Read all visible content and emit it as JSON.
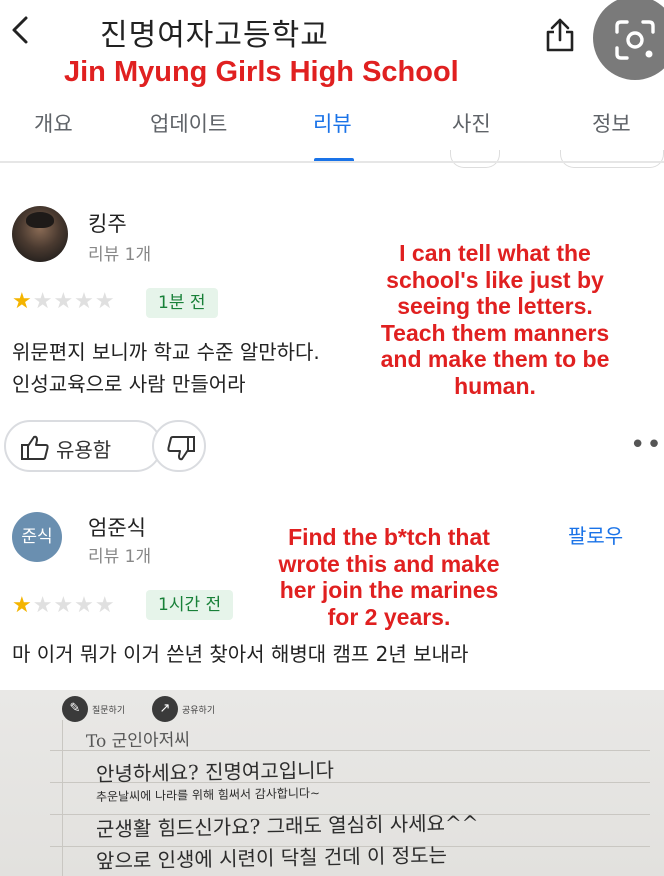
{
  "header": {
    "title_ko": "진명여자고등학교",
    "title_en": "Jin Myung Girls High School"
  },
  "tabs": [
    {
      "label": "개요",
      "active": false
    },
    {
      "label": "업데이트",
      "active": false
    },
    {
      "label": "리뷰",
      "active": true
    },
    {
      "label": "사진",
      "active": false
    },
    {
      "label": "정보",
      "active": false
    }
  ],
  "reviews": [
    {
      "author": "킹주",
      "review_count": "리뷰 1개",
      "rating": 1,
      "time": "1분 전",
      "text_lines": [
        "위문편지 보니까 학교 수준 알만하다.",
        "인성교육으로 사람 만들어라"
      ],
      "translation_lines": [
        "I can tell what the",
        "school's like just by",
        "seeing the letters.",
        "Teach them manners",
        "and make them to be",
        "human."
      ],
      "helpful_label": "유용함"
    },
    {
      "author": "엄준식",
      "avatar_text": "준식",
      "review_count": "리뷰 1개",
      "rating": 1,
      "time": "1시간 전",
      "text_lines": [
        "마 이거 뭐가 이거 쓴년 찾아서 해병대 캠프 2년 보내라"
      ],
      "translation_lines": [
        "Find the b*tch that",
        "wrote this and make",
        "her join the marines",
        "for 2 years."
      ],
      "follow_label": "팔로우"
    }
  ],
  "letter": {
    "buttons": [
      "질문하기",
      "공유하기"
    ],
    "lines": [
      "To 군인아저씨",
      "안녕하세요? 진명여고입니다",
      "추운날씨에 나라를 위해 힘써서 감사합니다~",
      "군생활 힘드신가요? 그래도 열심히 사세요^^",
      "앞으로 인생에 시련이 닥칠 건데 이 정도는"
    ]
  },
  "colors": {
    "accent": "#1a73e8",
    "translation_overlay": "#e02020",
    "star_on": "#f4b400",
    "badge_bg": "#e6f4ea",
    "badge_text": "#188038"
  },
  "icons": [
    "back-icon",
    "share-icon",
    "lens-icon",
    "thumbs-up-icon",
    "thumbs-down-icon",
    "more-icon"
  ]
}
